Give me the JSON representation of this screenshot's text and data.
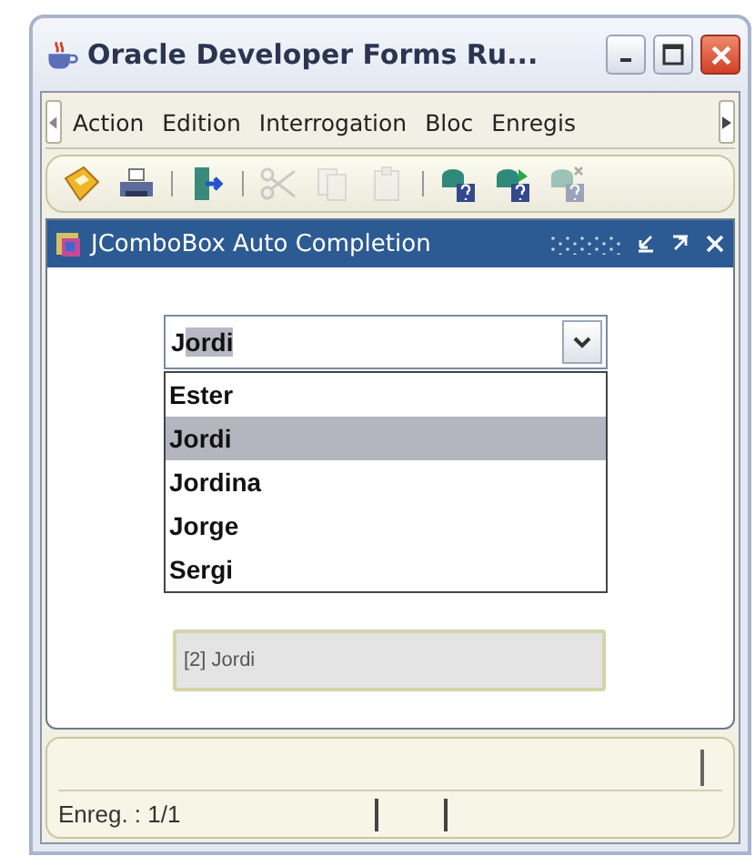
{
  "window": {
    "title": "Oracle Developer Forms Ru..."
  },
  "menu_bar": {
    "items": [
      "Action",
      "Edition",
      "Interrogation",
      "Bloc",
      "Enregis"
    ]
  },
  "toolbar": {
    "buttons": [
      {
        "kind": "save",
        "disabled": false
      },
      {
        "kind": "print",
        "disabled": false
      },
      {
        "kind": "separator"
      },
      {
        "kind": "exit",
        "disabled": false
      },
      {
        "kind": "separator"
      },
      {
        "kind": "cut",
        "disabled": true
      },
      {
        "kind": "copy",
        "disabled": true
      },
      {
        "kind": "paste",
        "disabled": true
      },
      {
        "kind": "separator"
      },
      {
        "kind": "query",
        "disabled": false
      },
      {
        "kind": "execute",
        "disabled": false
      },
      {
        "kind": "cancel",
        "disabled": true
      }
    ]
  },
  "inner_window": {
    "title": "JComboBox Auto Completion"
  },
  "combo": {
    "typed": "J",
    "completion": "ordi",
    "options": [
      {
        "label": "Ester",
        "selected": false
      },
      {
        "label": "Jordi",
        "selected": true
      },
      {
        "label": "Jordina",
        "selected": false
      },
      {
        "label": "Jorge",
        "selected": false
      },
      {
        "label": "Sergi",
        "selected": false
      }
    ]
  },
  "display_field": {
    "value": "[2] Jordi"
  },
  "status_bar": {
    "record": "Enreg. : 1/1"
  }
}
